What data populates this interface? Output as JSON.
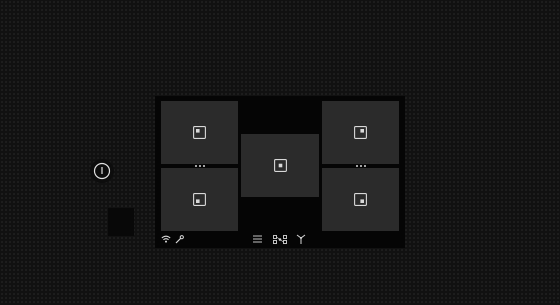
{
  "power": {
    "icon": "power-icon"
  },
  "cooktop": {
    "zones": [
      {
        "id": "top-left",
        "icon": "zone-marker-top-left-icon"
      },
      {
        "id": "bottom-left",
        "icon": "zone-marker-bottom-left-icon"
      },
      {
        "id": "center",
        "icon": "zone-marker-center-icon"
      },
      {
        "id": "top-right",
        "icon": "zone-marker-top-right-icon"
      },
      {
        "id": "bottom-right",
        "icon": "zone-marker-bottom-right-icon"
      }
    ],
    "bridges": [
      {
        "id": "left",
        "icon": "bridge-dots-icon"
      },
      {
        "id": "right",
        "icon": "bridge-dots-icon"
      }
    ]
  },
  "toolbar": {
    "icons": [
      "wifi-icon",
      "wrench-icon",
      "menu-icon",
      "link-icon",
      "fan-icon"
    ]
  },
  "colors": {
    "background": "#111111",
    "panel": "#050505",
    "zone": "#2b2b2b",
    "icon": "#d8d8d8"
  }
}
